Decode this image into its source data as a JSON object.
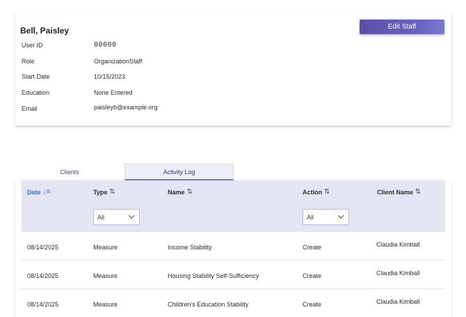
{
  "staff": {
    "name": "Bell, Paisley",
    "edit_label": "Edit Staff",
    "fields": [
      {
        "label": "User ID",
        "value": "00000"
      },
      {
        "label": "Role",
        "value": "OrganizationStaff"
      },
      {
        "label": "Start Date",
        "value": "10/15/2023"
      },
      {
        "label": "Education",
        "value": "None Entered"
      },
      {
        "label": "Email",
        "value": "paisleyb@example.org"
      }
    ]
  },
  "tabs": [
    {
      "label": "Clients",
      "active": false
    },
    {
      "label": "Activity Log",
      "active": true
    }
  ],
  "grid": {
    "columns": [
      {
        "label": "Date",
        "sort_icon": "sort-descending-icon",
        "active": true
      },
      {
        "label": "Type",
        "sort_icon": "sort-icon"
      },
      {
        "label": "Name",
        "sort_icon": "sort-icon"
      },
      {
        "label": "Action",
        "sort_icon": "sort-icon"
      },
      {
        "label": "Client Name",
        "sort_icon": "sort-icon"
      }
    ],
    "filters": {
      "type": {
        "selected": "All"
      },
      "action": {
        "selected": "All"
      }
    },
    "rows": [
      {
        "date": "08/14/2025",
        "type": "Measure",
        "name": "Income Stability",
        "action": "Create",
        "client": "Claudia Kimball"
      },
      {
        "date": "08/14/2025",
        "type": "Measure",
        "name": "Housing Stability Self-Sufficiency",
        "action": "Create",
        "client": "Claudia Kimball"
      },
      {
        "date": "08/14/2025",
        "type": "Measure",
        "name": "Children's Education Stability",
        "action": "Create",
        "client": "Claudia Kimball"
      }
    ]
  },
  "colors": {
    "accent": "#5b4fa6",
    "header_bg": "#e3e6f2",
    "active_sort": "#3e6fc4"
  }
}
